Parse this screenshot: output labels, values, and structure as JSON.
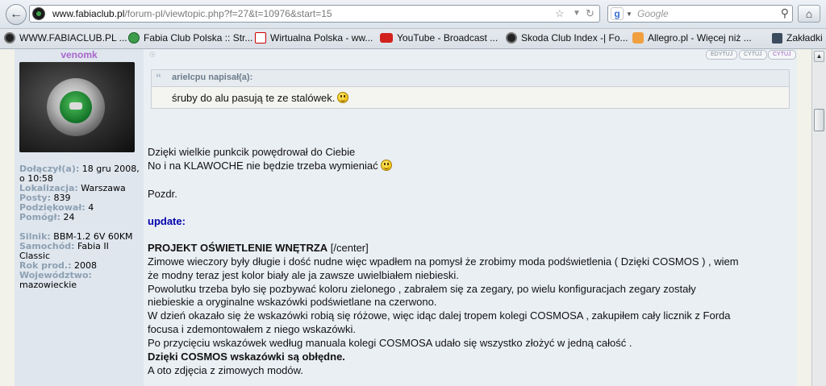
{
  "browser": {
    "url_domain": "www.fabiaclub.pl",
    "url_path": "/forum-pl/viewtopic.php?f=27&t=10976&start=15",
    "search_placeholder": "Google"
  },
  "bookmarks": [
    {
      "label": "WWW.FABIACLUB.PL ...",
      "icon": "skoda-icon"
    },
    {
      "label": "Fabia Club Polska :: Str...",
      "icon": "fabia-club-icon"
    },
    {
      "label": "Wirtualna Polska - ww...",
      "icon": "wp-icon"
    },
    {
      "label": "YouTube - Broadcast ...",
      "icon": "youtube-icon"
    },
    {
      "label": "Skoda Club Index -| Fo...",
      "icon": "skoda-icon"
    },
    {
      "label": "Allegro.pl - Więcej niż ...",
      "icon": "allegro-icon"
    }
  ],
  "bookmarks_menu": "Zakładki",
  "profile": {
    "username": "venomk",
    "fields": [
      {
        "key": "Dołączył(a):",
        "value": "18 gru 2008, o 10:58"
      },
      {
        "key": "Lokalizacja:",
        "value": "Warszawa"
      },
      {
        "key": "Posty:",
        "value": "839"
      },
      {
        "key": "Podziękował:",
        "value": "4"
      },
      {
        "key": "Pomógł:",
        "value": "24"
      }
    ],
    "car_fields": [
      {
        "key": "Silnik:",
        "value": "BBM-1.2 6V 60KM"
      },
      {
        "key": "Samochód:",
        "value": "Fabia II Classic"
      },
      {
        "key": "Rok prod.:",
        "value": "2008"
      },
      {
        "key": "Województwo:",
        "value": "mazowieckie"
      }
    ]
  },
  "post": {
    "buttons": [
      "EDYTUJ",
      "CYTUJ",
      "CYTUJ"
    ],
    "quote_author": "arielcpu napisał(a):",
    "quote_text": "śruby do alu pasują te ze stalówek.",
    "lines": {
      "thanks1": "Dzięki wielkie punkcik powędrował do Ciebie",
      "thanks2": "No i na KLAWOCHE nie będzie trzeba wymieniać",
      "regards": "Pozdr.",
      "update": "update:",
      "project_title": "PROJEKT OŚWIETLENIE WNĘTRZA",
      "project_center": " [/center]",
      "p1": "Zimowe wieczory były długie i dość nudne więc wpadłem na pomysł że zrobimy moda podświetlenia ( Dzięki COSMOS ) , wiem",
      "p2": "że modny teraz jest kolor biały ale ja zawsze uwielbiałem niebieski.",
      "p3": "Powolutku trzeba było się pozbywać koloru zielonego , zabrałem się za zegary, po wielu konfiguracjach zegary zostały",
      "p4": "niebieskie a oryginalne wskazówki podświetlane na czerwono.",
      "p5": "W dzień okazało się że wskazówki robią się różowe, więc idąc dalej tropem kolegi COSMOSA , zakupiłem cały licznik z Forda",
      "p6": "focusa i zdemontowałem z niego wskazówki.",
      "p7": "Po przycięciu wskazówek według manuala kolegi COSMOSA udało się wszystko złożyć w jedną całość .",
      "p8": "Dzięki COSMOS wskazówki są obłędne.",
      "p9": "A oto zdjęcia z zimowych modów."
    }
  }
}
